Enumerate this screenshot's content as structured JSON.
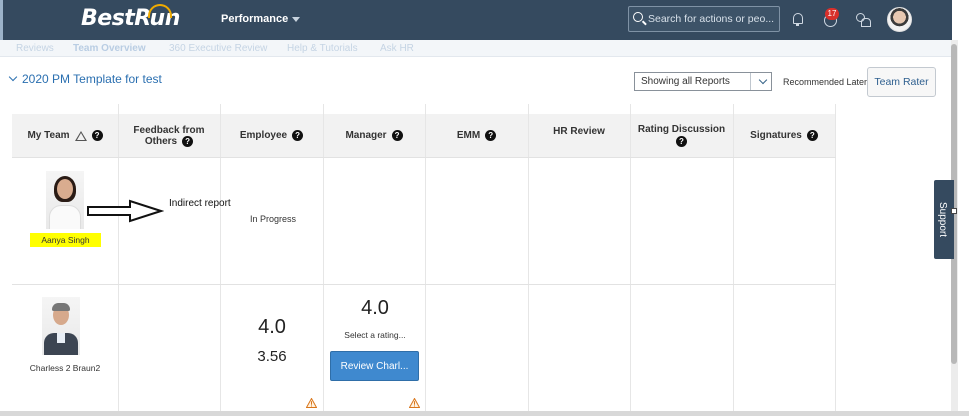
{
  "shell": {
    "logo_text": "BestRun",
    "module_label": "Performance",
    "search_placeholder": "Search for actions or peo...",
    "notification_count": "17"
  },
  "subnav": {
    "items": [
      "Reviews",
      "Team Overview",
      "360 Executive Review",
      "Help & Tutorials",
      "Ask HR"
    ],
    "active": "Team Overview"
  },
  "page": {
    "template_title": "2020 PM Template for test",
    "report_filter": "Showing all Reports",
    "recommended_label": "Recommended Later",
    "team_rater_button": "Team Rater",
    "support_tab": "Support"
  },
  "columns": [
    {
      "key": "my_team",
      "label": "My Team"
    },
    {
      "key": "feedback",
      "label_line1": "Feedback from",
      "label_line2": "Others"
    },
    {
      "key": "employee",
      "label": "Employee"
    },
    {
      "key": "manager",
      "label": "Manager"
    },
    {
      "key": "emm",
      "label": "EMM"
    },
    {
      "key": "hr_review",
      "label": "HR Review"
    },
    {
      "key": "rating_discussion",
      "label": "Rating Discussion"
    },
    {
      "key": "signatures",
      "label": "Signatures"
    }
  ],
  "rows": [
    {
      "name": "Aanya Singh",
      "annotation": "Indirect report",
      "employee_status": "In Progress"
    },
    {
      "name": "Charless 2 Braun2",
      "employee_score": "4.0",
      "employee_score_detail": "3.56",
      "manager_score": "4.0",
      "manager_rating_prompt": "Select a rating...",
      "review_button": "Review Charl..."
    }
  ],
  "colors": {
    "shell": "#354a5f",
    "accent_link": "#2a6fb0",
    "button_blue": "#3f89cf",
    "highlight": "#ffff00",
    "badge": "#d9302b"
  },
  "icons": [
    "search-icon",
    "bell-icon",
    "todo-icon",
    "people-icon",
    "help-icon",
    "sort-icon",
    "warning-icon",
    "dropdown-icon"
  ]
}
